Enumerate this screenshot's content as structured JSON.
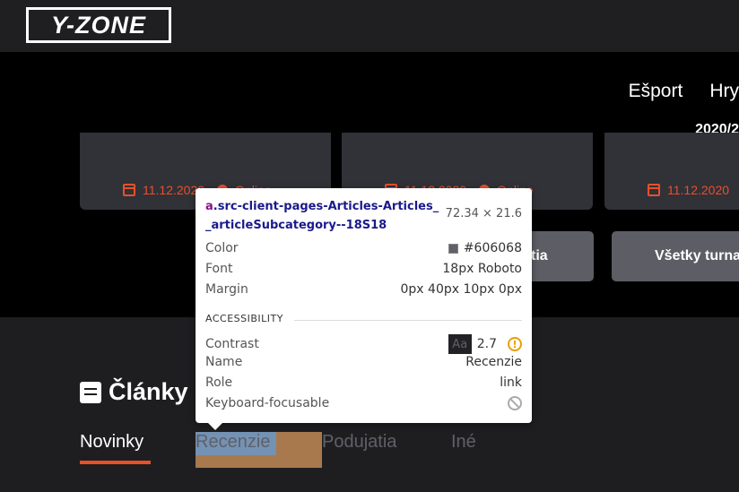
{
  "header": {
    "logo_text": "Y-ZONE"
  },
  "nav": {
    "items": [
      "Ešport",
      "Hry"
    ],
    "cut_text": "2020/2"
  },
  "cards": [
    {
      "date": "11.12.2020",
      "location": "Online"
    },
    {
      "date": "11.12.2020",
      "location": "Online"
    },
    {
      "date": "11.12.2020",
      "location": ""
    }
  ],
  "buttons": {
    "partial_label": "tia",
    "all_tournaments": "Všetky turna"
  },
  "articles": {
    "title": "Články",
    "tabs": [
      "Novinky",
      "Recenzie",
      "Podujatia",
      "Iné"
    ],
    "active_tab": "Novinky"
  },
  "tooltip": {
    "selector_tag": "a",
    "selector_class": ".src-client-pages-Articles-Articles__articleSubcategory--18S18",
    "size": "72.34 × 21.6",
    "rows": {
      "color_label": "Color",
      "color_value": "#606068",
      "font_label": "Font",
      "font_value": "18px Roboto",
      "margin_label": "Margin",
      "margin_value": "0px 40px 10px 0px"
    },
    "accessibility_heading": "ACCESSIBILITY",
    "a11y": {
      "contrast_label": "Contrast",
      "contrast_sample": "Aa",
      "contrast_value": "2.7",
      "name_label": "Name",
      "name_value": "Recenzie",
      "role_label": "Role",
      "role_value": "link",
      "focusable_label": "Keyboard-focusable"
    }
  },
  "colors": {
    "accent": "#e8502a",
    "card_bg": "#313138",
    "button_bg": "#5d5d65",
    "muted_text": "#606068"
  }
}
